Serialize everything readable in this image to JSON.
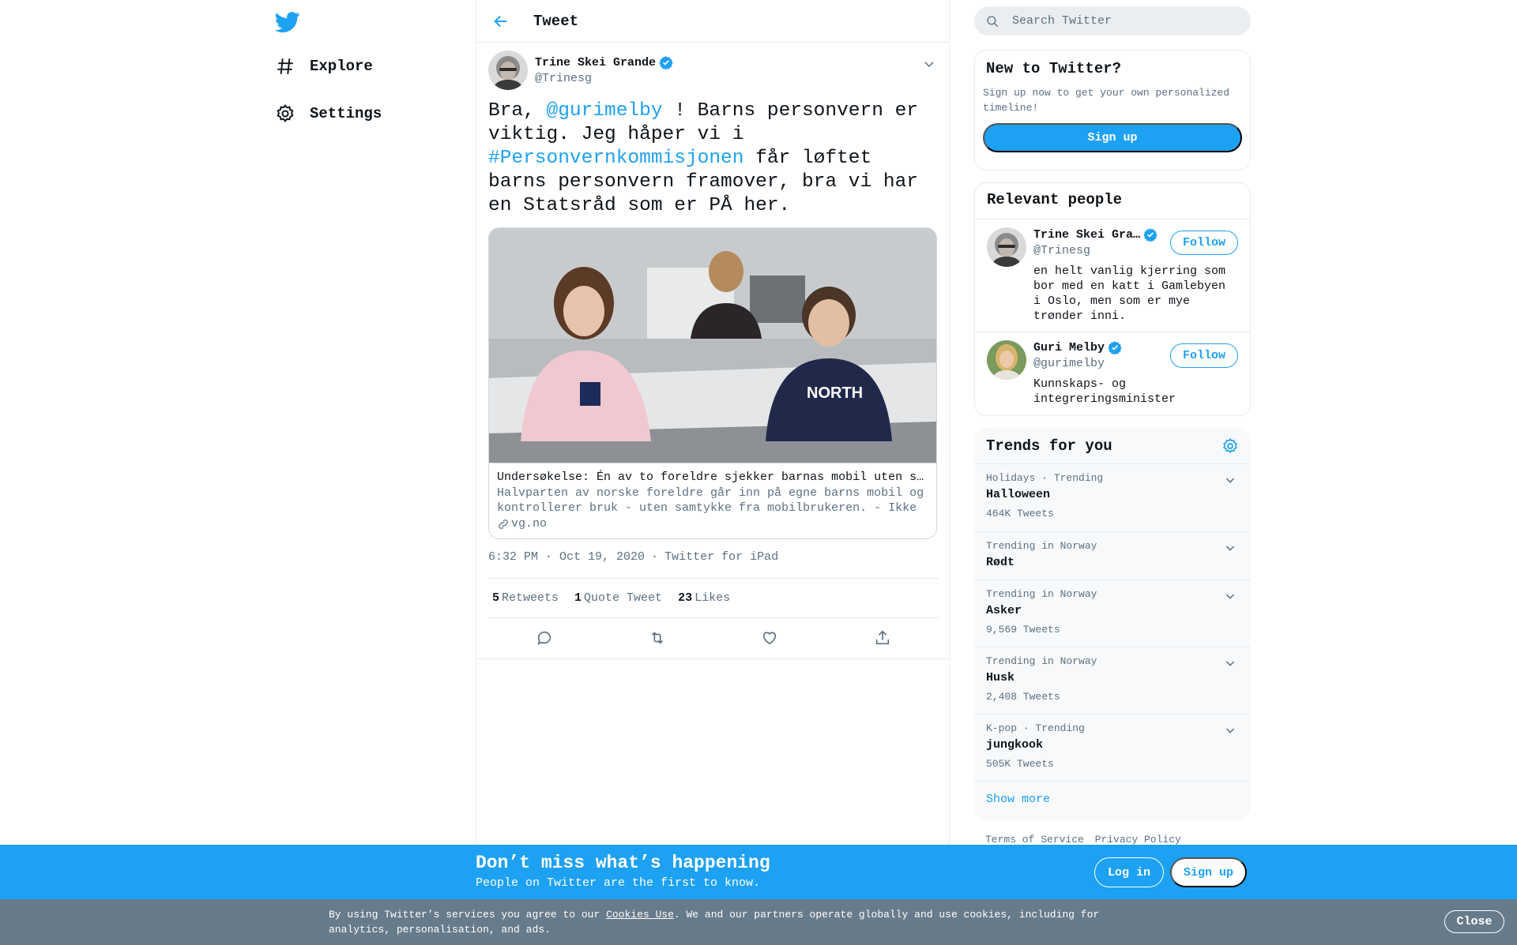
{
  "nav": {
    "logo_icon": "twitter-bird-icon",
    "items": [
      {
        "label": "Explore",
        "icon": "hashtag-icon"
      },
      {
        "label": "Settings",
        "icon": "gear-icon"
      }
    ]
  },
  "header": {
    "back_icon": "arrow-left-icon",
    "title": "Tweet"
  },
  "tweet": {
    "author_name": "Trine Skei Grande",
    "author_handle": "@Trinesg",
    "verified": true,
    "text_parts": [
      {
        "text": "Bra, ",
        "link": false
      },
      {
        "text": "@gurimelby",
        "link": true
      },
      {
        "text": " ! Barns personvern er viktig. Jeg håper vi i ",
        "link": false
      },
      {
        "text": "#Personvernkommisjonen",
        "link": true
      },
      {
        "text": " får løftet barns personvern framover, bra vi har en Statsråd som er PÅ her.",
        "link": false
      }
    ],
    "card": {
      "title": "Undersøkelse: Én av to foreldre sjekker barnas mobil uten samtykke",
      "description": "Halvparten av norske foreldre går inn på egne barns mobil og kontrollerer bruk - uten samtykke fra mobilbrukeren. - Ikke greit, sier statsråd.",
      "domain": "vg.no"
    },
    "time": "6:32 PM · Oct 19, 2020",
    "source": "Twitter for iPad",
    "separator": "·",
    "stats": [
      {
        "num": "5",
        "label": "Retweets"
      },
      {
        "num": "1",
        "label": "Quote Tweet"
      },
      {
        "num": "23",
        "label": "Likes"
      }
    ]
  },
  "search": {
    "placeholder": "Search Twitter"
  },
  "new_to_twitter": {
    "title": "New to Twitter?",
    "description": "Sign up now to get your own personalized timeline!",
    "signup_label": "Sign up"
  },
  "relevant_people": {
    "title": "Relevant people",
    "people": [
      {
        "name": "Trine Skei Gra…",
        "handle": "@Trinesg",
        "bio": "en helt vanlig kjerring som bor med en katt i Gamlebyen i Oslo, men som er mye trønder inni.",
        "follow_label": "Follow"
      },
      {
        "name": "Guri Melby",
        "handle": "@gurimelby",
        "bio": "Kunnskaps- og integreringsminister",
        "follow_label": "Follow"
      }
    ]
  },
  "trends": {
    "title": "Trends for you",
    "items": [
      {
        "context": "Holidays · Trending",
        "name": "Halloween",
        "count": "464K Tweets"
      },
      {
        "context": "Trending in Norway",
        "name": "Rødt",
        "count": ""
      },
      {
        "context": "Trending in Norway",
        "name": "Asker",
        "count": "9,569 Tweets"
      },
      {
        "context": "Trending in Norway",
        "name": "Husk",
        "count": "2,408 Tweets"
      },
      {
        "context": "K-pop · Trending",
        "name": "jungkook",
        "count": "505K Tweets"
      }
    ],
    "show_more": "Show more"
  },
  "footer": {
    "links": [
      "Terms of Service",
      "Privacy Policy"
    ]
  },
  "signup_bar": {
    "headline": "Don’t miss what’s happening",
    "sub": "People on Twitter are the first to know.",
    "login_label": "Log in",
    "signup_label": "Sign up"
  },
  "cookie_bar": {
    "text_before": "By using Twitter’s services you agree to our ",
    "link_text": "Cookies Use",
    "text_after": ". We and our partners operate globally and use cookies, including for analytics, personalisation, and ads.",
    "close_label": "Close"
  },
  "colors": {
    "accent": "#1da1f2",
    "secondary_text": "#5b7083",
    "border": "#e6ecf0",
    "cookie_bg": "#687b8a"
  }
}
